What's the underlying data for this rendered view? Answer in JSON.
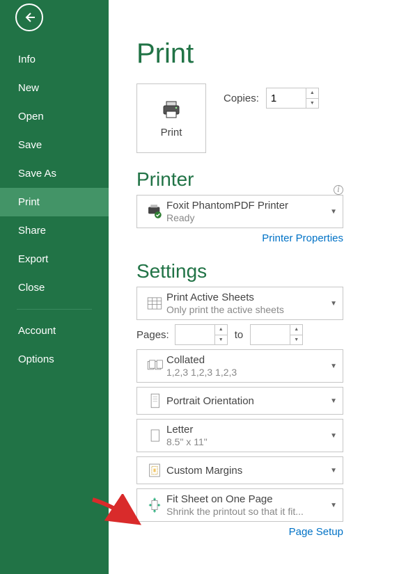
{
  "colors": {
    "brand": "#217346",
    "link": "#0072c6"
  },
  "sidebar": {
    "items": [
      {
        "label": "Info"
      },
      {
        "label": "New"
      },
      {
        "label": "Open"
      },
      {
        "label": "Save"
      },
      {
        "label": "Save As"
      },
      {
        "label": "Print"
      },
      {
        "label": "Share"
      },
      {
        "label": "Export"
      },
      {
        "label": "Close"
      }
    ],
    "footer": [
      {
        "label": "Account"
      },
      {
        "label": "Options"
      }
    ]
  },
  "page": {
    "title": "Print",
    "print_button": "Print",
    "copies_label": "Copies:",
    "copies_value": "1"
  },
  "printer_section": {
    "title": "Printer",
    "selected": {
      "name": "Foxit PhantomPDF Printer",
      "status": "Ready"
    },
    "properties_link": "Printer Properties"
  },
  "settings_section": {
    "title": "Settings",
    "print_what": {
      "primary": "Print Active Sheets",
      "secondary": "Only print the active sheets"
    },
    "pages": {
      "label": "Pages:",
      "from": "",
      "to_label": "to",
      "to": ""
    },
    "collation": {
      "primary": "Collated",
      "secondary": "1,2,3    1,2,3    1,2,3"
    },
    "orientation": {
      "primary": "Portrait Orientation"
    },
    "paper": {
      "primary": "Letter",
      "secondary": "8.5\" x 11\""
    },
    "margins": {
      "primary": "Custom Margins"
    },
    "scaling": {
      "primary": "Fit Sheet on One Page",
      "secondary": "Shrink the printout so that it fit..."
    },
    "page_setup_link": "Page Setup"
  }
}
